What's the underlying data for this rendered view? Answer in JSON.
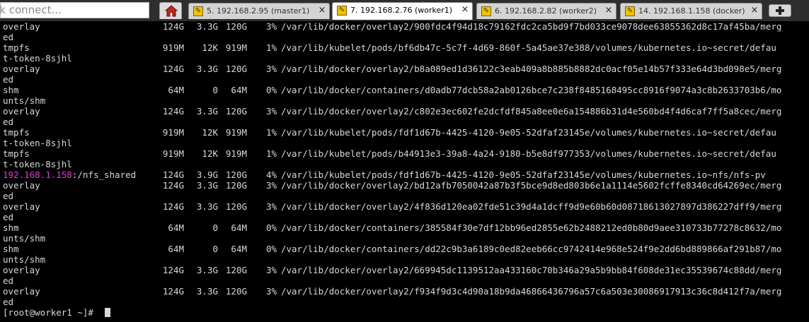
{
  "quick_connect": {
    "text": "ck connect..."
  },
  "tabs": [
    {
      "label": "5. 192.168.2.95 (master1)",
      "active": false
    },
    {
      "label": "7. 192.168.2.76 (worker1)",
      "active": true
    },
    {
      "label": "6. 192.168.2.82 (worker2)",
      "active": false
    },
    {
      "label": "14. 192.168.1.158 (docker)",
      "active": false
    }
  ],
  "close_glyph": "×",
  "rows": [
    {
      "fs": "overlay",
      "size": "124G",
      "used": "3.3G",
      "avail": "120G",
      "pct": "3%",
      "mount": "/var/lib/docker/overlay2/900fdc4f94d18c79162fdc2ca5bd9f7bd033ce9078dee63855362d8c17af45ba/merg",
      "wrap": "ed"
    },
    {
      "fs": "tmpfs",
      "size": "919M",
      "used": "12K",
      "avail": "919M",
      "pct": "1%",
      "mount": "/var/lib/kubelet/pods/bf6db47c-5c7f-4d69-860f-5a45ae37e388/volumes/kubernetes.io~secret/defau",
      "wrap": "t-token-8sjhl"
    },
    {
      "fs": "overlay",
      "size": "124G",
      "used": "3.3G",
      "avail": "120G",
      "pct": "3%",
      "mount": "/var/lib/docker/overlay2/b8a089ed1d36122c3eab409a8b885b8882dc0acf05e14b57f333e64d3bd098e5/merg",
      "wrap": "ed"
    },
    {
      "fs": "shm",
      "size": "64M",
      "used": "0",
      "avail": "64M",
      "pct": "0%",
      "mount": "/var/lib/docker/containers/d0adb77dcb58a2ab0126bce7c238f8485168495cc8916f9074a3c8b2633703b6/mo",
      "wrap": "unts/shm"
    },
    {
      "fs": "overlay",
      "size": "124G",
      "used": "3.3G",
      "avail": "120G",
      "pct": "3%",
      "mount": "/var/lib/docker/overlay2/c802e3ec602fe2dcfdf845a8ee0e6a154886b31d4e560bd4f4d6caf7ff5a8cec/merg",
      "wrap": "ed"
    },
    {
      "fs": "tmpfs",
      "size": "919M",
      "used": "12K",
      "avail": "919M",
      "pct": "1%",
      "mount": "/var/lib/kubelet/pods/fdf1d67b-4425-4120-9e05-52dfaf23145e/volumes/kubernetes.io~secret/defau",
      "wrap": "t-token-8sjhl"
    },
    {
      "fs": "tmpfs",
      "size": "919M",
      "used": "12K",
      "avail": "919M",
      "pct": "1%",
      "mount": "/var/lib/kubelet/pods/b44913e3-39a8-4a24-9180-b5e8df977353/volumes/kubernetes.io~secret/defau",
      "wrap": "t-token-8sjhl"
    },
    {
      "fs": "",
      "fs_host": "192.168.1.158",
      "fs_path": ":/nfs_shared",
      "size": "124G",
      "used": "3.9G",
      "avail": "120G",
      "pct": "4%",
      "mount": "/var/lib/kubelet/pods/fdf1d67b-4425-4120-9e05-52dfaf23145e/volumes/kubernetes.io~nfs/nfs-pv",
      "wrap": null
    },
    {
      "fs": "overlay",
      "size": "124G",
      "used": "3.3G",
      "avail": "120G",
      "pct": "3%",
      "mount": "/var/lib/docker/overlay2/bd12afb7050042a87b3f5bce9d8ed803b6e1a1114e5602fcffe8340cd64269ec/merg",
      "wrap": "ed"
    },
    {
      "fs": "overlay",
      "size": "124G",
      "used": "3.3G",
      "avail": "120G",
      "pct": "3%",
      "mount": "/var/lib/docker/overlay2/4f836d120ea02fde51c39d4a1dcff9d9e60b60d08718613027897d386227dff9/merg",
      "wrap": "ed"
    },
    {
      "fs": "shm",
      "size": "64M",
      "used": "0",
      "avail": "64M",
      "pct": "0%",
      "mount": "/var/lib/docker/containers/385584f30e7df12bb96ed2855e62b2488212ed0b80d9aee310733b77278c8632/mo",
      "wrap": "unts/shm"
    },
    {
      "fs": "shm",
      "size": "64M",
      "used": "0",
      "avail": "64M",
      "pct": "0%",
      "mount": "/var/lib/docker/containers/dd22c9b3a6189c0ed82eeb66cc9742414e968e524f9e2dd6bd889866af291b87/mo",
      "wrap": "unts/shm"
    },
    {
      "fs": "overlay",
      "size": "124G",
      "used": "3.3G",
      "avail": "120G",
      "pct": "3%",
      "mount": "/var/lib/docker/overlay2/669945dc1139512aa433160c70b346a29a5b9bb84f608de31ec35539674c88dd/merg",
      "wrap": "ed"
    },
    {
      "fs": "overlay",
      "size": "124G",
      "used": "3.3G",
      "avail": "120G",
      "pct": "3%",
      "mount": "/var/lib/docker/overlay2/f934f9d3c4d90a18b9da46866436796a57c6a503e30086917913c36c8d412f7a/merg",
      "wrap": "ed"
    }
  ],
  "prompt": "[root@worker1 ~]# ",
  "colors": {
    "terminal_bg": "#000000",
    "terminal_fg": "#d8d8d8",
    "host_highlight": "#e23cd6",
    "tab_icon": "#f2c200",
    "tabbar_bg": "#2e2e2e"
  }
}
